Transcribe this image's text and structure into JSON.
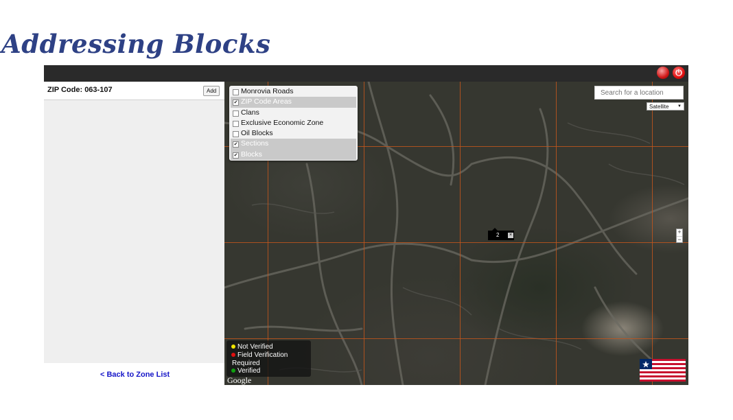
{
  "slide": {
    "title": "Addressing Blocks"
  },
  "sidebar": {
    "zip_label": "ZIP Code: 063-107",
    "add_label": "Add",
    "back_link": "< Back to Zone List"
  },
  "layers": [
    {
      "label": "Monrovia Roads",
      "checked": false
    },
    {
      "label": "ZIP Code Areas",
      "checked": true
    },
    {
      "label": "Clans",
      "checked": false
    },
    {
      "label": "Exclusive Economic Zone",
      "checked": false
    },
    {
      "label": "Oil Blocks",
      "checked": false
    },
    {
      "label": "Sections",
      "checked": true
    },
    {
      "label": "Blocks",
      "checked": true
    }
  ],
  "search": {
    "placeholder": "Search for a location"
  },
  "map_type": {
    "selected": "Satellite"
  },
  "zoom": {
    "in": "+",
    "out": "−"
  },
  "marker": {
    "number": "2",
    "close": "×"
  },
  "legend": {
    "not_verified": "Not Verified",
    "field_verification": "Field Verification",
    "required": "Required",
    "verified": "Verified"
  },
  "attribution": "Google",
  "colors": {
    "title": "#2e4185",
    "grid": "#c2561c",
    "dot_not_verified": "#f2e600",
    "dot_field_verification": "#e01010",
    "dot_verified": "#10a010",
    "link": "#1515c8"
  },
  "icons": {
    "globe": "globe-icon",
    "power": "power-icon",
    "flag": "liberia-flag-icon"
  }
}
